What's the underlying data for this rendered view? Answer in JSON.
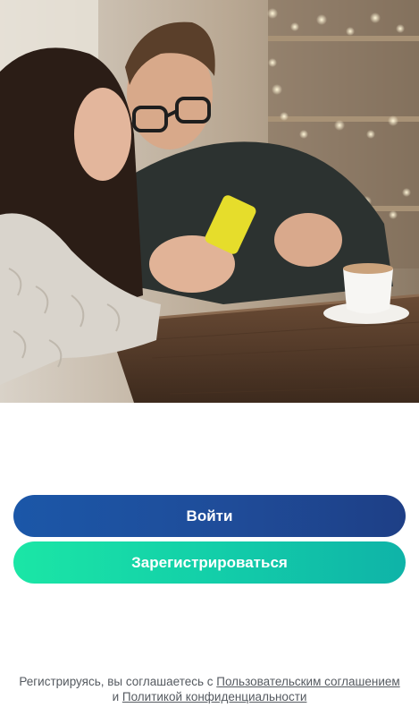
{
  "hero": {
    "image": "couple-with-smartphone-in-cafe"
  },
  "actions": {
    "login_label": "Войти",
    "register_label": "Зарегистрироваться"
  },
  "legal": {
    "prefix": "Регистрируясь, вы соглашаетесь с ",
    "terms_link": "Пользовательским соглашением",
    "conjunction": " и ",
    "privacy_link": "Политикой конфиденциальности"
  },
  "colors": {
    "login_start": "#1b57a8",
    "login_end": "#1e3f86",
    "register_start": "#1be6a6",
    "register_end": "#0fb3a8",
    "text_muted": "#555a60"
  }
}
